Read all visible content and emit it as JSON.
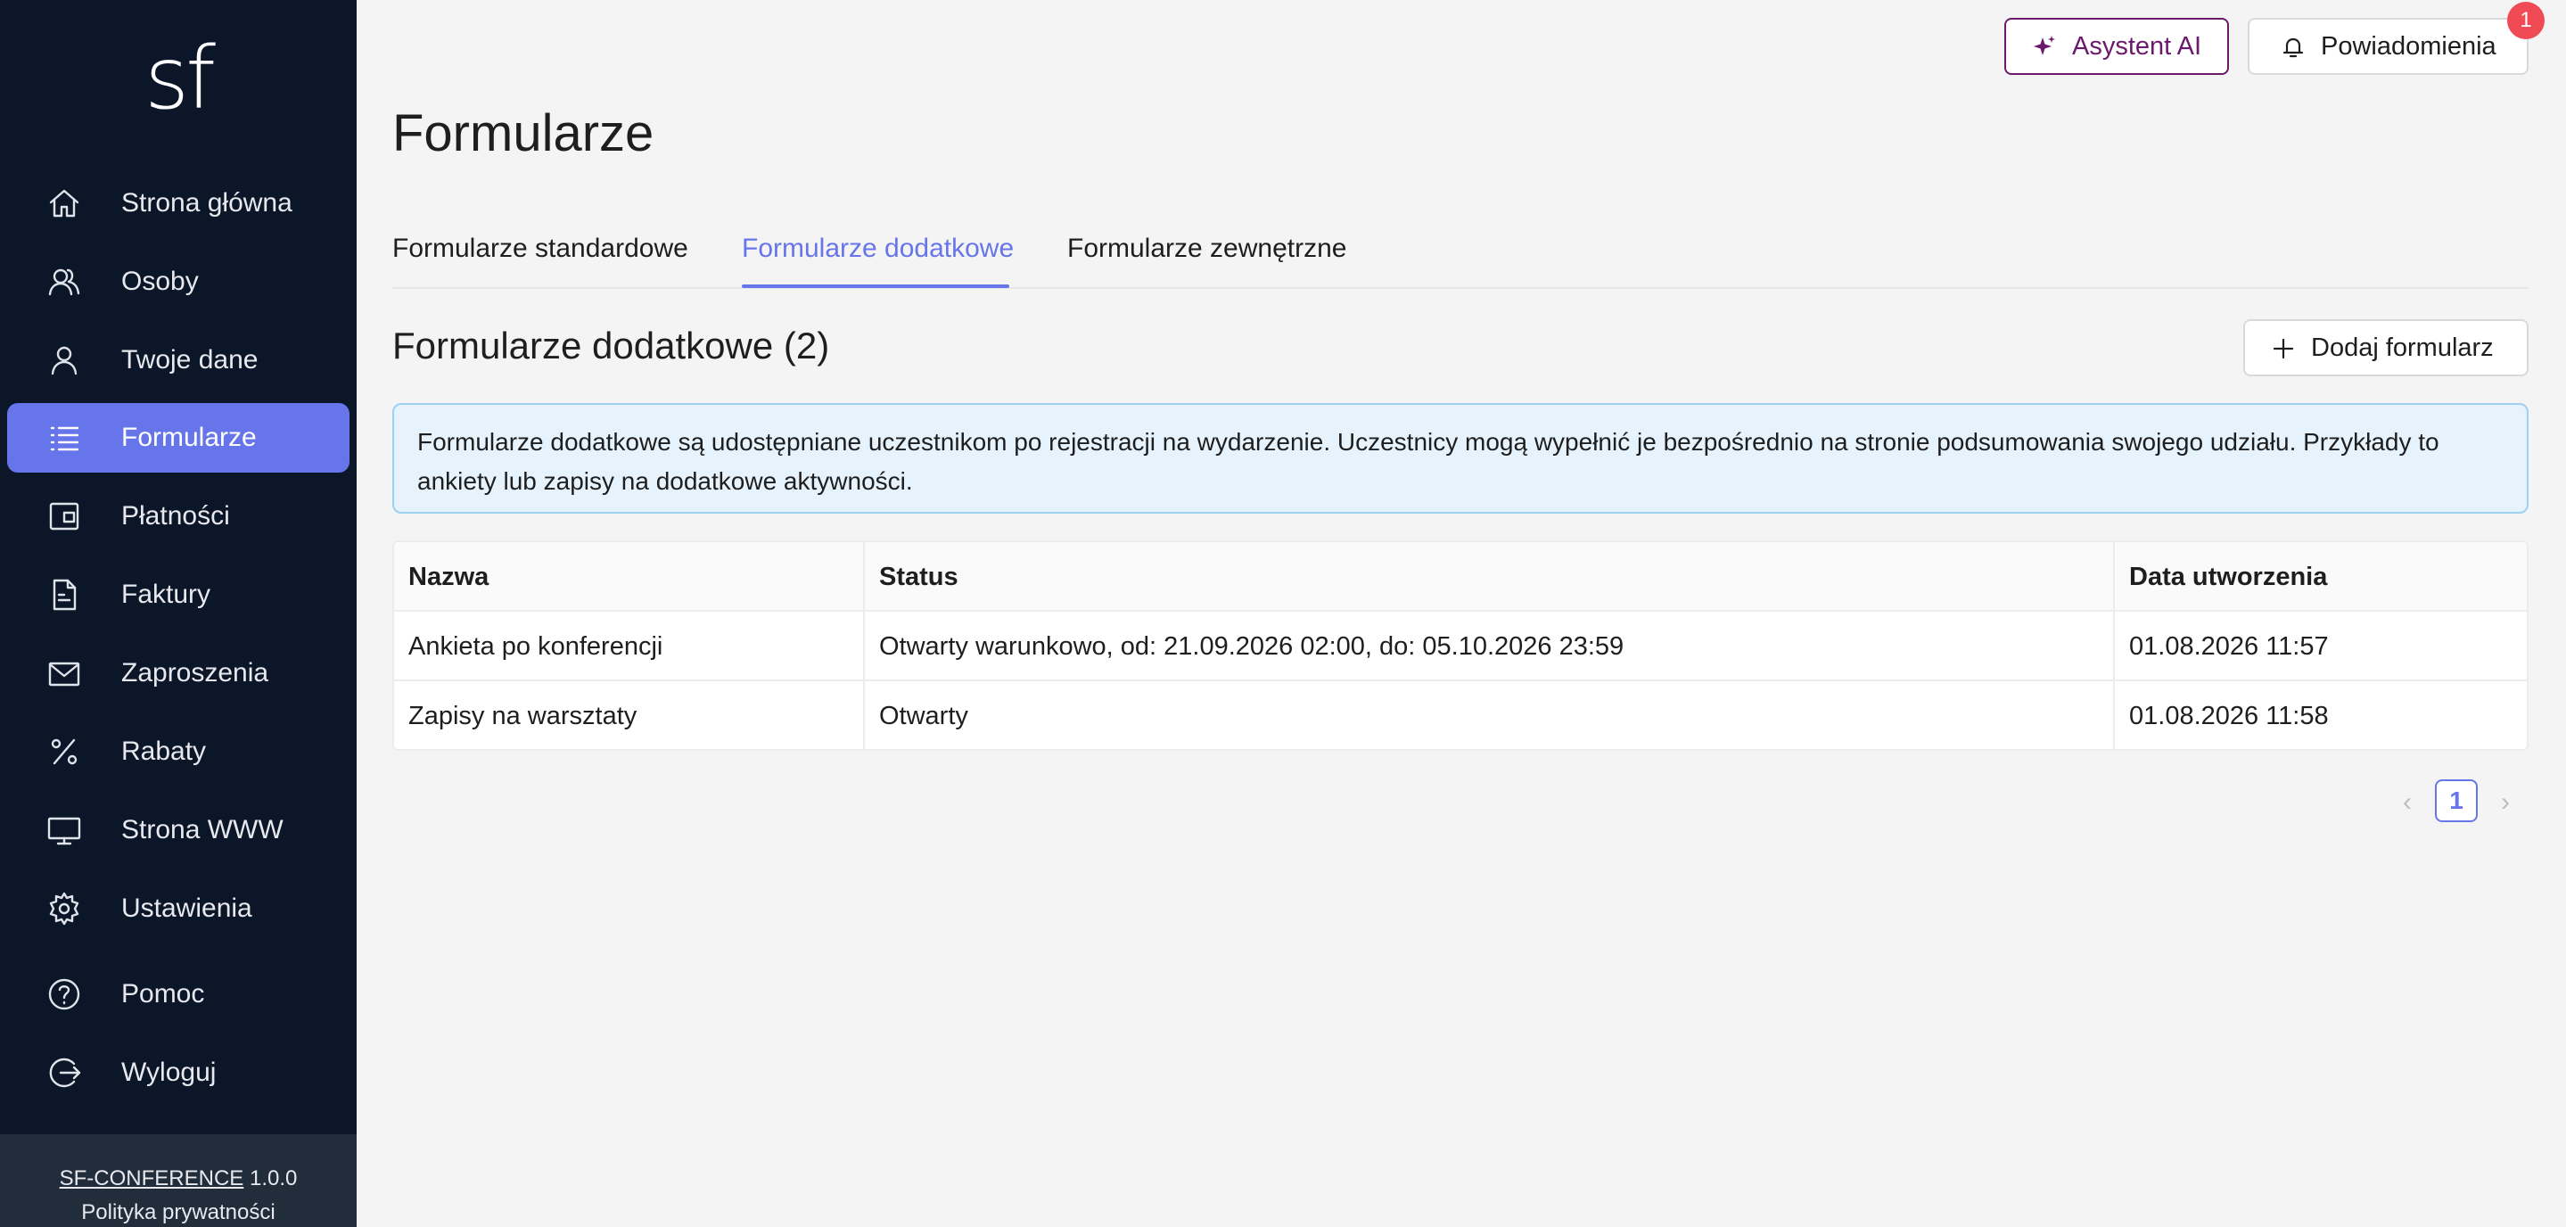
{
  "app": {
    "logo": "sf"
  },
  "sidebar": {
    "items": [
      {
        "label": "Strona główna",
        "icon": "home-icon"
      },
      {
        "label": "Osoby",
        "icon": "people-icon"
      },
      {
        "label": "Twoje dane",
        "icon": "user-icon"
      },
      {
        "label": "Formularze",
        "icon": "list-icon",
        "active": true
      },
      {
        "label": "Płatności",
        "icon": "wallet-icon"
      },
      {
        "label": "Faktury",
        "icon": "document-icon"
      },
      {
        "label": "Zaproszenia",
        "icon": "mail-icon"
      },
      {
        "label": "Rabaty",
        "icon": "percent-icon"
      },
      {
        "label": "Strona WWW",
        "icon": "monitor-icon"
      },
      {
        "label": "Ustawienia",
        "icon": "gear-icon"
      },
      {
        "label": "Pomoc",
        "icon": "help-icon"
      },
      {
        "label": "Wyloguj",
        "icon": "logout-icon"
      }
    ],
    "footer": {
      "product": "SF-CONFERENCE",
      "version": "1.0.0",
      "privacy": "Polityka prywatności"
    }
  },
  "header": {
    "ai_label": "Asystent AI",
    "notifications_label": "Powiadomienia",
    "notifications_count": "1"
  },
  "page": {
    "title": "Formularze",
    "tabs": [
      {
        "label": "Formularze standardowe"
      },
      {
        "label": "Formularze dodatkowe",
        "active": true
      },
      {
        "label": "Formularze zewnętrzne"
      }
    ],
    "section_title": "Formularze dodatkowe (2)",
    "add_button": "Dodaj formularz",
    "info": "Formularze dodatkowe są udostępniane uczestnikom po rejestracji na wydarzenie. Uczestnicy mogą wypełnić je bezpośrednio na stronie podsumowania swojego udziału. Przykłady to ankiety lub zapisy na dodatkowe aktywności."
  },
  "table": {
    "columns": [
      "Nazwa",
      "Status",
      "Data utworzenia"
    ],
    "rows": [
      [
        "Ankieta po konferencji",
        "Otwarty warunkowo, od: 21.09.2026 02:00, do: 05.10.2026 23:59",
        "01.08.2026 11:57"
      ],
      [
        "Zapisy na warsztaty",
        "Otwarty",
        "01.08.2026 11:58"
      ]
    ]
  },
  "pagination": {
    "current": "1"
  },
  "colors": {
    "accent": "#6675ea",
    "sidebar": "#0b1628",
    "ai": "#6b1a6b",
    "badge": "#f04b55",
    "info_bg": "#e6f3fd"
  }
}
